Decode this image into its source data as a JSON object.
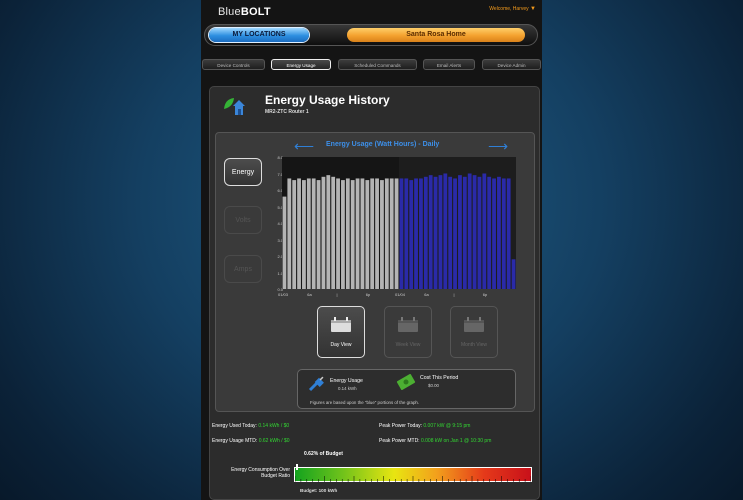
{
  "header": {
    "logo_prefix": "Blue",
    "logo_bold": "BOLT",
    "welcome": "Welcome, Harvey",
    "my_locations": "MY LOCATIONS",
    "location_name": "Santa Rosa Home"
  },
  "tabs": [
    {
      "label": "Device Controls",
      "active": false
    },
    {
      "label": "Energy Usage",
      "active": true
    },
    {
      "label": "Scheduled Commands",
      "active": false
    },
    {
      "label": "Email Alerts",
      "active": false
    },
    {
      "label": "Device Admin",
      "active": false
    }
  ],
  "panel": {
    "title": "Energy Usage History",
    "subtitle": "MR2-ZTC Router 1"
  },
  "side_buttons": [
    {
      "label": "Energy",
      "active": true
    },
    {
      "label": "Volts",
      "active": false
    },
    {
      "label": "Amps",
      "active": false
    }
  ],
  "view_buttons": [
    {
      "label": "Day View",
      "active": true
    },
    {
      "label": "Week View",
      "active": false
    },
    {
      "label": "Month View",
      "active": false
    }
  ],
  "summary": {
    "energy_label": "Energy Usage",
    "energy_value": "0.14 kWh",
    "cost_label": "Cost This Period",
    "cost_value": "$0.00",
    "footnote": "Figures are based upon the \"blue\" portions of the graph."
  },
  "stats": {
    "used_today_label": "Energy Used Today:",
    "used_today_value": "0.14 kWh / $0",
    "usage_mtd_label": "Energy Usage MTD:",
    "usage_mtd_value": "0.62 kWh / $0",
    "peak_today_label": "Peak Power Today:",
    "peak_today_value": "0.007 kW @ 9:15 pm",
    "peak_mtd_label": "Peak Power MTD:",
    "peak_mtd_value": "0.008 kW on Jan 1 @ 10:30 pm"
  },
  "budget": {
    "percent_text": "0.62% of Budget",
    "label": "Energy Consumption Over Budget Ratio",
    "total_text": "Budget: 100 kWh",
    "ratio": 0.0062
  },
  "colors": {
    "accent_blue": "#3d8fe8",
    "location_orange": "#f4a12e",
    "bar_gray": "#b4b4b4",
    "bar_blue": "#2a2aa8",
    "value_green": "#33d833"
  },
  "chart_data": {
    "type": "bar",
    "title": "Energy Usage (Watt Hours) - Daily",
    "ylim": [
      0,
      8
    ],
    "yticks": [
      "8.0",
      "7.0",
      "6.0",
      "5.0",
      "4.0",
      "3.0",
      "2.0",
      "1.0",
      "0.0"
    ],
    "xticks": [
      "01/03",
      "6a",
      "|",
      "6p",
      "01/04",
      "6a",
      "|",
      "6p"
    ],
    "gray_values": [
      5.6,
      6.7,
      6.6,
      6.7,
      6.6,
      6.7,
      6.7,
      6.6,
      6.8,
      6.9,
      6.8,
      6.7,
      6.6,
      6.7,
      6.6,
      6.7,
      6.7,
      6.6,
      6.7,
      6.7,
      6.6,
      6.7,
      6.7,
      6.7
    ],
    "blue_values": [
      6.7,
      6.7,
      6.6,
      6.7,
      6.7,
      6.8,
      6.9,
      6.8,
      6.9,
      7.0,
      6.8,
      6.7,
      6.9,
      6.8,
      7.0,
      6.9,
      6.8,
      7.0,
      6.8,
      6.7,
      6.8,
      6.7,
      6.7,
      1.8
    ]
  }
}
